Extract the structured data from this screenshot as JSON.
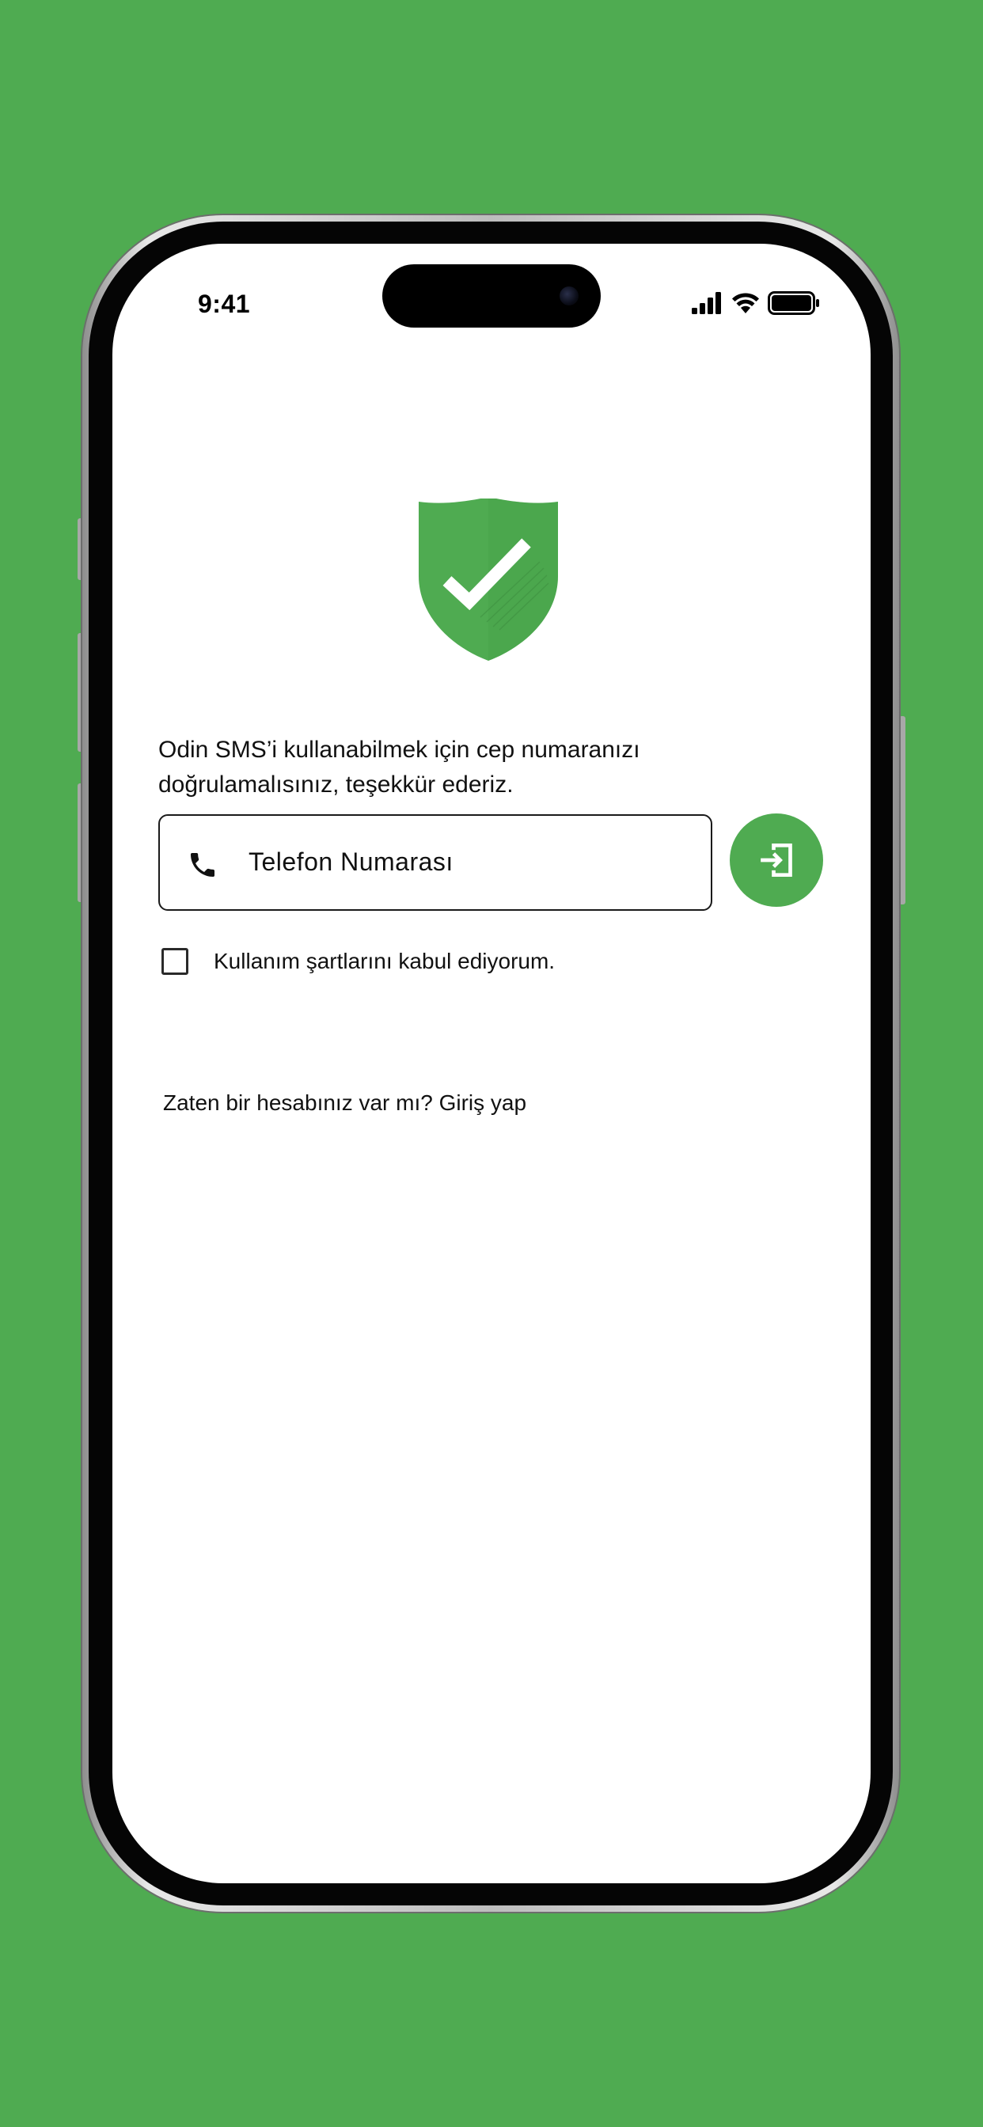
{
  "colors": {
    "background": "#4fab51",
    "accent": "#4fab51",
    "screen": "#ffffff",
    "text": "#111111"
  },
  "status_bar": {
    "time": "9:41",
    "icons": [
      "signal-icon",
      "wifi-icon",
      "battery-icon"
    ]
  },
  "hero": {
    "icon": "shield-check-icon"
  },
  "intro": {
    "text": "Odin SMS’i kullanabilmek için cep numaranızı doğrulamalısınız, teşekkür ederiz."
  },
  "phone_field": {
    "icon": "phone-icon",
    "placeholder": "Telefon Numarası",
    "value": ""
  },
  "submit": {
    "icon": "login-arrow-icon"
  },
  "terms": {
    "checked": false,
    "label": "Kullanım şartlarını kabul ediyorum."
  },
  "footer": {
    "login_prompt": "Zaten bir hesabınız var mı? Giriş yap"
  }
}
